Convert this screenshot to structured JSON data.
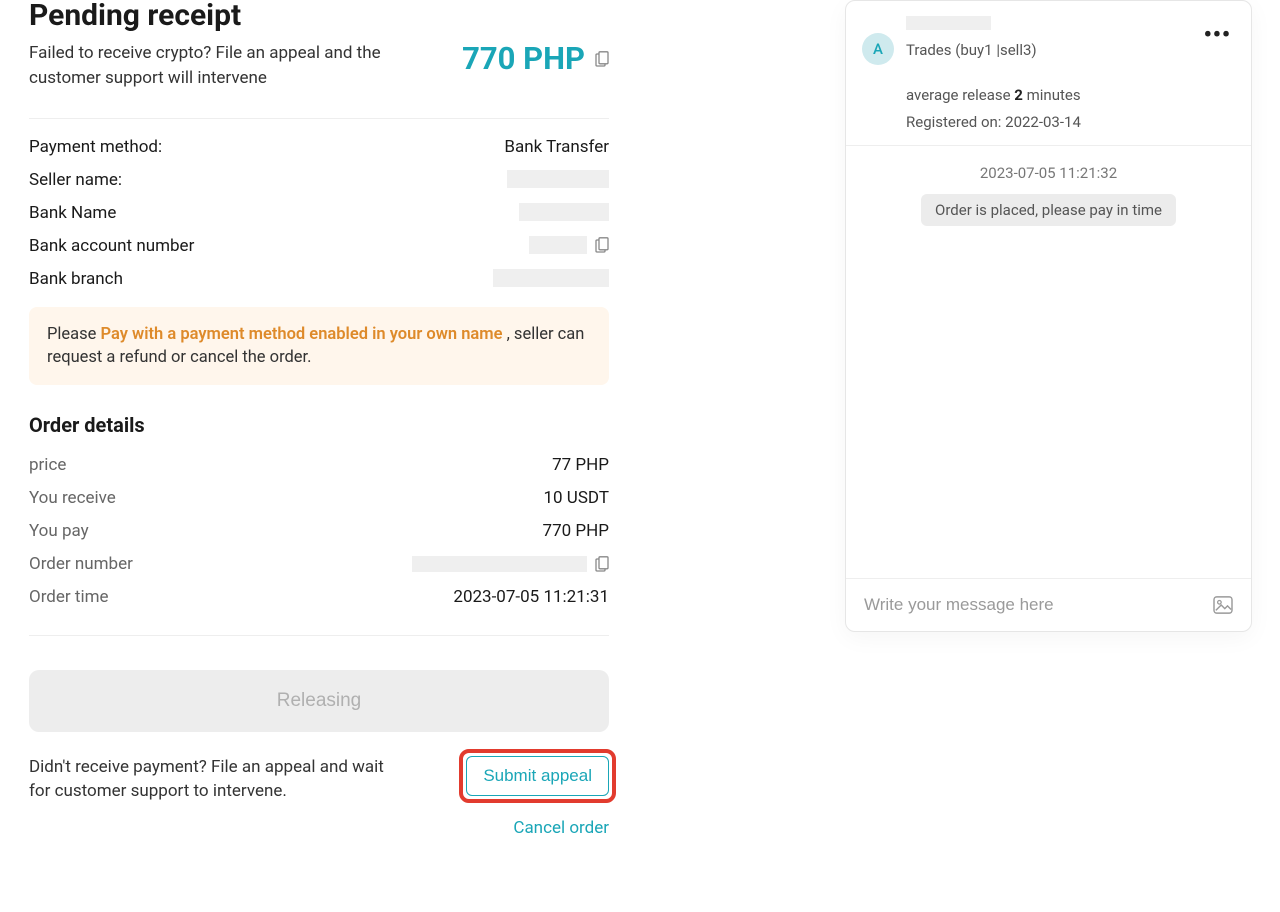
{
  "header": {
    "title": "Pending receipt",
    "subtitle": "Failed to receive crypto? File an appeal and the customer support will intervene",
    "amount": "770 PHP"
  },
  "payment": {
    "method_label": "Payment method:",
    "method_value": "Bank Transfer",
    "seller_label": "Seller name:",
    "bank_name_label": "Bank Name",
    "bank_account_label": "Bank account number",
    "bank_branch_label": "Bank branch"
  },
  "notice": {
    "prefix": "Please ",
    "highlight": "Pay with a payment method enabled in your own name",
    "suffix": " , seller can request a refund or cancel the order."
  },
  "order": {
    "section_title": "Order details",
    "price_label": "price",
    "price_value": "77 PHP",
    "receive_label": "You receive",
    "receive_value": "10 USDT",
    "pay_label": "You pay",
    "pay_value": "770 PHP",
    "number_label": "Order number",
    "time_label": "Order time",
    "time_value": "2023-07-05 11:21:31"
  },
  "actions": {
    "releasing": "Releasing",
    "appeal_text": "Didn't receive payment? File an appeal and wait for customer support to intervene.",
    "submit_appeal": "Submit appeal",
    "cancel_order": "Cancel order"
  },
  "chat": {
    "avatar_letter": "A",
    "trades_prefix": "Trades (buy",
    "buy_count": "1",
    "sell_prefix": " |sell",
    "sell_count": "3",
    "trades_suffix": ")",
    "release_prefix": "average release ",
    "release_value": "2",
    "release_suffix": " minutes",
    "registered_prefix": "Registered on: ",
    "registered_date": "2022-03-14",
    "timestamp": "2023-07-05 11:21:32",
    "system_msg": "Order is placed, please pay in time",
    "input_placeholder": "Write your message here"
  }
}
